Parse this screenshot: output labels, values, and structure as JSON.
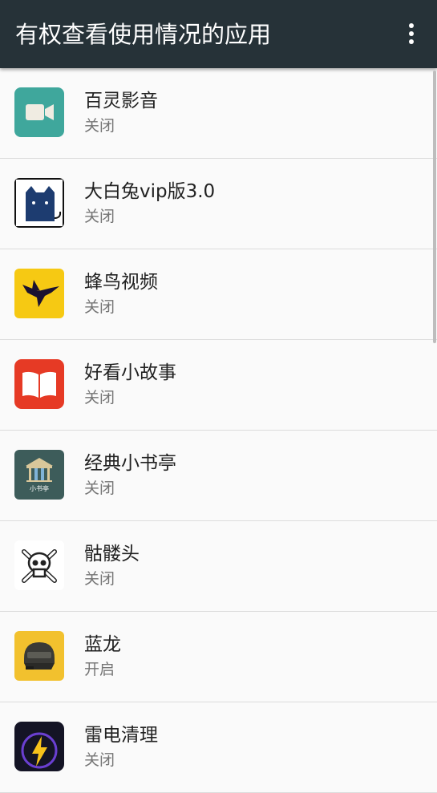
{
  "header": {
    "title": "有权查看使用情况的应用",
    "overflow_icon": "more-vert-icon"
  },
  "colors": {
    "appbar": "#263238",
    "background": "#fafafa",
    "divider": "#dcdcdc",
    "primary_text": "#212121",
    "secondary_text": "#757575"
  },
  "apps": [
    {
      "name": "百灵影音",
      "status": "关闭",
      "icon": "video-camera-icon"
    },
    {
      "name": "大白兔vip版3.0",
      "status": "关闭",
      "icon": "cat-icon"
    },
    {
      "name": "蜂鸟视频",
      "status": "关闭",
      "icon": "hummingbird-icon"
    },
    {
      "name": "好看小故事",
      "status": "关闭",
      "icon": "open-book-icon"
    },
    {
      "name": "经典小书亭",
      "status": "关闭",
      "icon": "pavilion-icon",
      "icon_text": "小书亭"
    },
    {
      "name": "骷髅头",
      "status": "关闭",
      "icon": "skull-crossbones-icon"
    },
    {
      "name": "蓝龙",
      "status": "开启",
      "icon": "helmet-icon"
    },
    {
      "name": "雷电清理",
      "status": "关闭",
      "icon": "lightning-icon"
    }
  ]
}
